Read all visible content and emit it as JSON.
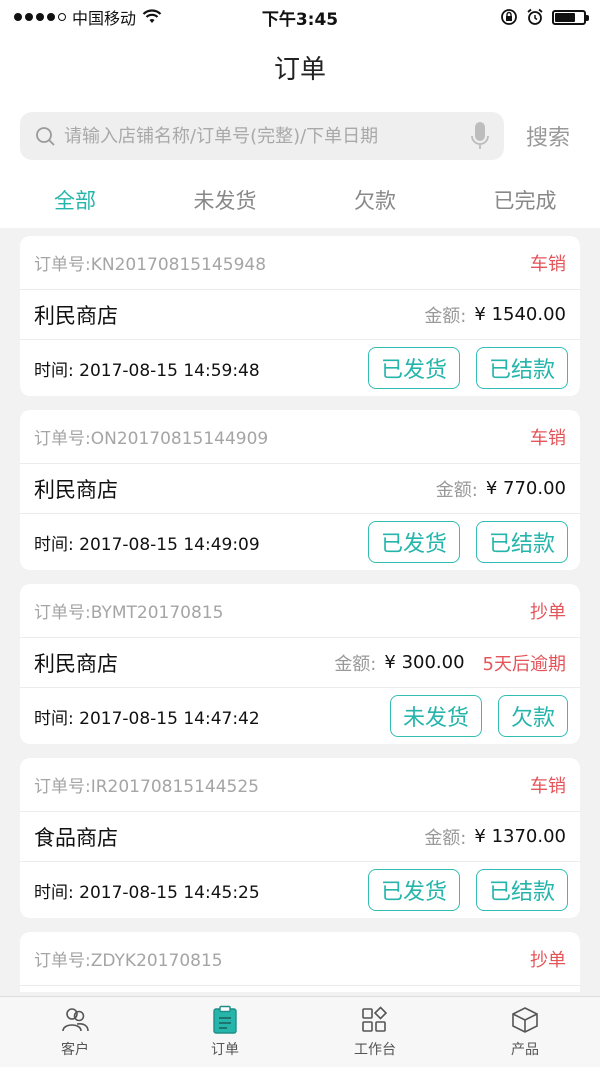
{
  "status_bar": {
    "carrier": "中国移动",
    "time": "下午3:45"
  },
  "header": {
    "title": "订单"
  },
  "search": {
    "placeholder": "请输入店铺名称/订单号(完整)/下单日期",
    "button_label": "搜索"
  },
  "tabs": [
    {
      "label": "全部",
      "active": true
    },
    {
      "label": "未发货",
      "active": false
    },
    {
      "label": "欠款",
      "active": false
    },
    {
      "label": "已完成",
      "active": false
    }
  ],
  "orders": [
    {
      "order_no": "订单号:KN20170815145948",
      "type": "车销",
      "shop": "利民商店",
      "amount_label": "金额:",
      "amount": "¥ 1540.00",
      "overdue": "",
      "time": "时间: 2017-08-15 14:59:48",
      "actions": [
        "已发货",
        "已结款"
      ]
    },
    {
      "order_no": "订单号:ON20170815144909",
      "type": "车销",
      "shop": "利民商店",
      "amount_label": "金额:",
      "amount": "¥ 770.00",
      "overdue": "",
      "time": "时间: 2017-08-15 14:49:09",
      "actions": [
        "已发货",
        "已结款"
      ]
    },
    {
      "order_no": "订单号:BYMT20170815",
      "type": "抄单",
      "shop": "利民商店",
      "amount_label": "金额:",
      "amount": "¥ 300.00",
      "overdue": "5天后逾期",
      "time": "时间: 2017-08-15 14:47:42",
      "actions": [
        "未发货",
        "欠款"
      ]
    },
    {
      "order_no": "订单号:IR20170815144525",
      "type": "车销",
      "shop": "食品商店",
      "amount_label": "金额:",
      "amount": "¥ 1370.00",
      "overdue": "",
      "time": "时间: 2017-08-15 14:45:25",
      "actions": [
        "已发货",
        "已结款"
      ]
    },
    {
      "order_no": "订单号:ZDYK20170815",
      "type": "抄单"
    }
  ],
  "bottom_nav": [
    {
      "label": "客户",
      "icon": "customers-icon",
      "active": false
    },
    {
      "label": "订单",
      "icon": "orders-icon",
      "active": true
    },
    {
      "label": "工作台",
      "icon": "workbench-icon",
      "active": false
    },
    {
      "label": "产品",
      "icon": "product-icon",
      "active": false
    }
  ],
  "colors": {
    "accent": "#26b5ab",
    "alert": "#e4555a"
  }
}
